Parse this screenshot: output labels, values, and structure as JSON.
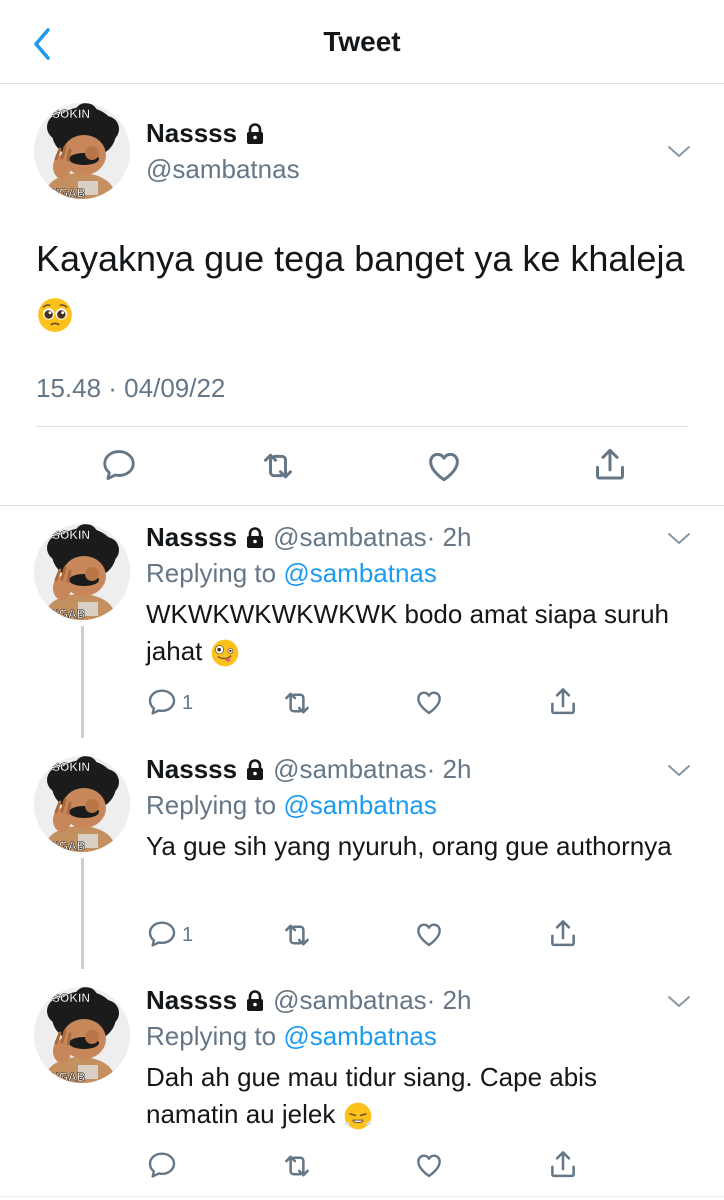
{
  "header": {
    "title": "Tweet"
  },
  "main_tweet": {
    "name": "Nassss",
    "handle": "@sambatnas",
    "text": "Kayaknya gue tega banget ya ke khaleja",
    "emoji": "pleading-face",
    "timestamp": "15.48 · 04/09/22",
    "avatar_text_top": "SOKIN",
    "avatar_text_bottom": "NGAB"
  },
  "replies": [
    {
      "name": "Nassss",
      "handle": "@sambatnas",
      "time": "· 2h",
      "replying_prefix": "Replying to",
      "replying_to": "@sambatnas",
      "text": "WKWKWKWKWKWK bodo amat siapa suruh jahat",
      "emoji": "zany-face",
      "reply_count": "1",
      "avatar_text_top": "SOKIN",
      "avatar_text_bottom": "NGAB"
    },
    {
      "name": "Nassss",
      "handle": "@sambatnas",
      "time": "· 2h",
      "replying_prefix": "Replying to",
      "replying_to": "@sambatnas",
      "text": "Ya gue sih yang nyuruh, orang gue authornya",
      "emoji": "",
      "reply_count": "1",
      "avatar_text_top": "SOKIN",
      "avatar_text_bottom": "NGAB"
    },
    {
      "name": "Nassss",
      "handle": "@sambatnas",
      "time": "· 2h",
      "replying_prefix": "Replying to",
      "replying_to": "@sambatnas",
      "text": "Dah ah gue mau tidur siang. Cape abis namatin au jelek",
      "emoji": "triumph-face",
      "reply_count": "",
      "avatar_text_top": "SOKIN",
      "avatar_text_bottom": "NGAB"
    }
  ],
  "colors": {
    "accent": "#1d9bf0",
    "text": "#14171a",
    "secondary": "#657786",
    "divider": "#dfe3e6",
    "thread_line": "#c4cfd6"
  },
  "icons": [
    "back-chevron-icon",
    "lock-icon",
    "chevron-down-icon",
    "reply-icon",
    "retweet-icon",
    "like-icon",
    "share-icon"
  ]
}
